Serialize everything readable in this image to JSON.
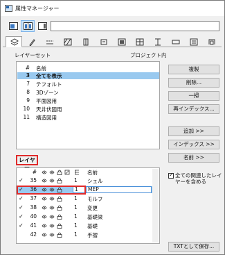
{
  "window": {
    "title": "属性マネージャー"
  },
  "toolbar": {
    "icons": [
      "list-view-icon",
      "split-view-icon",
      "panel-view-icon"
    ],
    "search_value": ""
  },
  "tabs": [
    "layers",
    "pens",
    "line-types",
    "fills",
    "composites",
    "profiles",
    "building-materials",
    "surfaces",
    "zones",
    "mep",
    "markup",
    "operation-profiles"
  ],
  "layer_sets": {
    "label": "レイヤーセット",
    "project_label": "プロジェクト内",
    "header_num": "#",
    "header_name": "名前",
    "rows": [
      {
        "num": "3",
        "name": "全てを表示",
        "selected": true
      },
      {
        "num": "7",
        "name": "テフォルト",
        "selected": false
      },
      {
        "num": "8",
        "name": "3Dゾーン",
        "selected": false
      },
      {
        "num": "9",
        "name": "平面図用",
        "selected": false
      },
      {
        "num": "10",
        "name": "天井伏図用",
        "selected": false
      },
      {
        "num": "11",
        "name": "構造図用",
        "selected": false
      }
    ]
  },
  "buttons": {
    "duplicate": "複製",
    "delete": "削除...",
    "unify": "一掃",
    "reindex": "再インデックス...",
    "add": "追加 >>",
    "index": "インデックス >>",
    "name": "名前 >>",
    "txt_save": "TXTとして保存..."
  },
  "layers": {
    "label": "レイヤー",
    "header_num": "#",
    "header_name": "名前",
    "rows": [
      {
        "checked": true,
        "num": "35",
        "pen": "1",
        "name": "シェル",
        "editing": false
      },
      {
        "checked": true,
        "num": "36",
        "pen": "1",
        "name": "MEP",
        "editing": true
      },
      {
        "checked": true,
        "num": "37",
        "pen": "1",
        "name": "モルフ",
        "editing": false
      },
      {
        "checked": true,
        "num": "38",
        "pen": "1",
        "name": "変更",
        "editing": false
      },
      {
        "checked": true,
        "num": "40",
        "pen": "1",
        "name": "基礎梁",
        "editing": false
      },
      {
        "checked": true,
        "num": "41",
        "pen": "1",
        "name": "基礎",
        "editing": false
      },
      {
        "checked": false,
        "num": "42",
        "pen": "1",
        "name": "手摺",
        "editing": false
      }
    ]
  },
  "options": {
    "include_all_related": "全ての関連したレイヤーを含める",
    "include_all_related_checked": true
  }
}
